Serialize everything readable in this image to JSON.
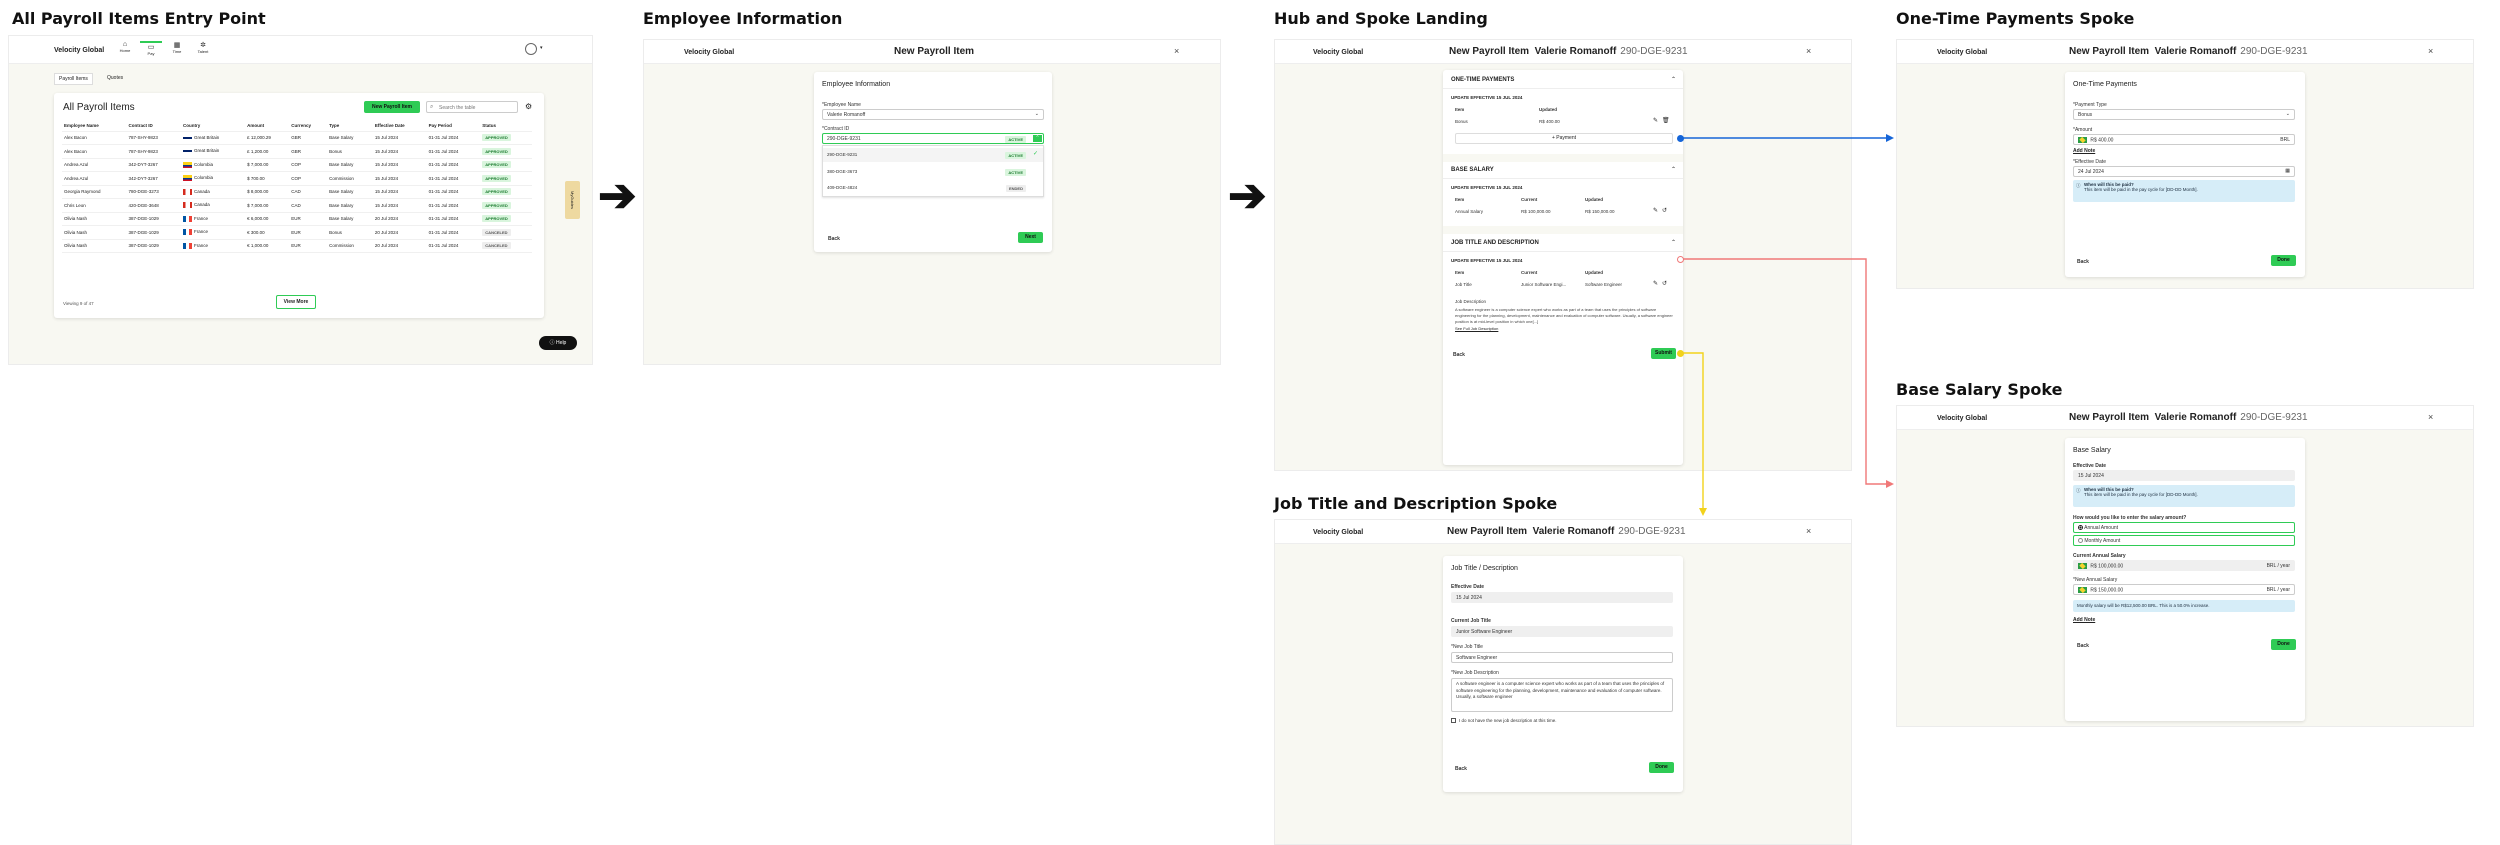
{
  "sections": {
    "entry": "All Payroll Items Entry Point",
    "employee": "Employee Information",
    "hub": "Hub and Spoke Landing",
    "onetime": "One-Time Payments Spoke",
    "base": "Base Salary Spoke",
    "job": "Job Title and Description Spoke"
  },
  "brand": "Velocity Global",
  "modal_title": "New Payroll Item",
  "employee_name": "Valerie Romanoff",
  "contract_id": "290-DGE-9231",
  "close": "×",
  "entry": {
    "nav": [
      {
        "icon": "home-icon",
        "label": "Home"
      },
      {
        "icon": "pay-icon",
        "label": "Pay"
      },
      {
        "icon": "time-icon",
        "label": "Time"
      },
      {
        "icon": "talent-icon",
        "label": "Talent"
      }
    ],
    "tabs": [
      "Payroll Items",
      "Quotes"
    ],
    "title": "All Payroll Items",
    "new_btn": "New Payroll Item",
    "search_placeholder": "Search the table",
    "columns": [
      "Employee Name",
      "Contract ID",
      "Country",
      "Amount",
      "Currency",
      "Type",
      "Effective Date",
      "Pay Period",
      "Status"
    ],
    "rows": [
      [
        "Alex Bacon",
        "787-SHY-9823",
        "Great Britain",
        "£ 12,000.29",
        "GBR",
        "Base Salary",
        "15 Jul 2024",
        "01-31 Jul 2024",
        "APPROVED",
        "gb"
      ],
      [
        "Alex Bacon",
        "787-SHY-9823",
        "Great Britain",
        "£ 1,200.00",
        "GBR",
        "Bonus",
        "15 Jul 2024",
        "01-31 Jul 2024",
        "APPROVED",
        "gb"
      ],
      [
        "Andrea Azul",
        "342-DYT-3267",
        "Colombia",
        "$ 7,000.00",
        "COP",
        "Base Salary",
        "15 Jul 2024",
        "01-31 Jul 2024",
        "APPROVED",
        "co"
      ],
      [
        "Andrea Azul",
        "342-DYT-3267",
        "Colombia",
        "$ 700.00",
        "COP",
        "Commission",
        "15 Jul 2024",
        "01-31 Jul 2024",
        "APPROVED",
        "co"
      ],
      [
        "Georgia Raymond",
        "780-DGE-3273",
        "Canada",
        "$ 8,000.00",
        "CAD",
        "Base Salary",
        "15 Jul 2024",
        "01-31 Jul 2024",
        "APPROVED",
        "ca"
      ],
      [
        "Chris Leon",
        "420-DGE-3648",
        "Canada",
        "$ 7,000.00",
        "CAD",
        "Base Salary",
        "15 Jul 2024",
        "01-31 Jul 2024",
        "APPROVED",
        "ca"
      ],
      [
        "Olivia Nash",
        "387-DGE-1029",
        "France",
        "€ 6,000.00",
        "EUR",
        "Base Salary",
        "20 Jul 2024",
        "01-31 Jul 2024",
        "APPROVED",
        "fr"
      ],
      [
        "Olivia Nash",
        "387-DGE-1029",
        "France",
        "€ 300.00",
        "EUR",
        "Bonus",
        "20 Jul 2024",
        "01-31 Jul 2024",
        "CANCELED",
        "fr"
      ],
      [
        "Olivia Nash",
        "387-DGE-1029",
        "France",
        "€ 1,000.00",
        "EUR",
        "Commission",
        "20 Jul 2024",
        "01-31 Jul 2024",
        "CANCELED",
        "fr"
      ]
    ],
    "viewing": "Viewing 9 of 47",
    "view_more": "View More",
    "help": "Help",
    "side_tab": "MyGuides"
  },
  "emp": {
    "card_title": "Employee Information",
    "name_label": "*Employee Name",
    "name_value": "Valerie Romanoff",
    "contract_label": "*Contract ID",
    "contract_value": "290-DGE-9231",
    "options": [
      [
        "290-DGE-9231",
        "ACTIVE"
      ],
      [
        "380-DGE-3673",
        "ACTIVE"
      ],
      [
        "409-DGE-4824",
        "ENDED"
      ]
    ],
    "back": "Back",
    "next": "Next"
  },
  "hub": {
    "one_time": "ONE-TIME PAYMENTS",
    "base_salary": "BASE SALARY",
    "job_title": "JOB TITLE AND DESCRIPTION",
    "update": "UPDATE EFFECTIVE 15 JUL 2024",
    "item": "Item",
    "current": "Current",
    "updated": "Updated",
    "bonus": "Bonus",
    "bonus_val": "R$ 400.00",
    "add_payment": "+ Payment",
    "annual": "Annual Salary",
    "annual_cur": "R$ 100,000.00",
    "annual_upd": "R$ 150,000.00",
    "jt": "Job Title",
    "jt_cur": "Junior Software Engi...",
    "jt_upd": "Software Engineer",
    "jd_label": "Job Description",
    "jd_text": "A software engineer is a computer science expert who works as part of a team that uses the principles of software engineering for the planning, development, maintenance and evaluation of computer software. Usually, a software engineer position is at mid-level position in which one[...]",
    "see_full": "See Full Job Description",
    "back": "Back",
    "submit": "Submit"
  },
  "ot": {
    "card_title": "One-Time Payments",
    "type_label": "*Payment Type",
    "type_value": "Bonus",
    "amount_label": "*Amount",
    "amount_value": "R$ 400.00",
    "amount_cur": "BRL",
    "add_note": "Add Note",
    "date_label": "*Effective Date",
    "date_value": "24 Jul 2024",
    "info_title": "When will this be paid?",
    "info_text": "This item will be paid in the pay cycle for [DD-DD Month].",
    "back": "Back",
    "done": "Done"
  },
  "bs": {
    "card_title": "Base Salary",
    "date_label": "Effective Date",
    "date_value": "15 Jul 2024",
    "info_title": "When will this be paid?",
    "info_text": "This item will be paid in the pay cycle for [DD-DD Month].",
    "q": "How would you like to enter the salary amount?",
    "opt1": "Annual Amount",
    "opt2": "Monthly Amount",
    "cur_label": "Current Annual Salary",
    "cur_value": "R$ 100,000.00",
    "unit": "BRL / year",
    "new_label": "*New Annual Salary",
    "new_value": "R$ 150,000.00",
    "monthly_note": "Monthly salary will be R$12,500.00 BRL. This is a 50.0% increase.",
    "add_note": "Add Note",
    "back": "Back",
    "done": "Done"
  },
  "jt": {
    "card_title": "Job Title / Description",
    "date_label": "Effective Date",
    "date_value": "15 Jul 2024",
    "cur_label": "Current Job Title",
    "cur_value": "Junior Software Engineer",
    "new_label": "*New Job Title",
    "new_value": "Software Engineer",
    "desc_label": "*New Job Description",
    "desc_value": "A software engineer is a computer science expert who works as part of a team that uses the principles of software engineering for the planning, development, maintenance and evaluation of computer software. Usually, a software engineer",
    "checkbox": "I do not have the new job description at this time.",
    "back": "Back",
    "done": "Done"
  },
  "colors": {
    "green": "#2fcb55",
    "blue": "#1565d8",
    "red": "#f07878",
    "yellow": "#f2d21b"
  }
}
